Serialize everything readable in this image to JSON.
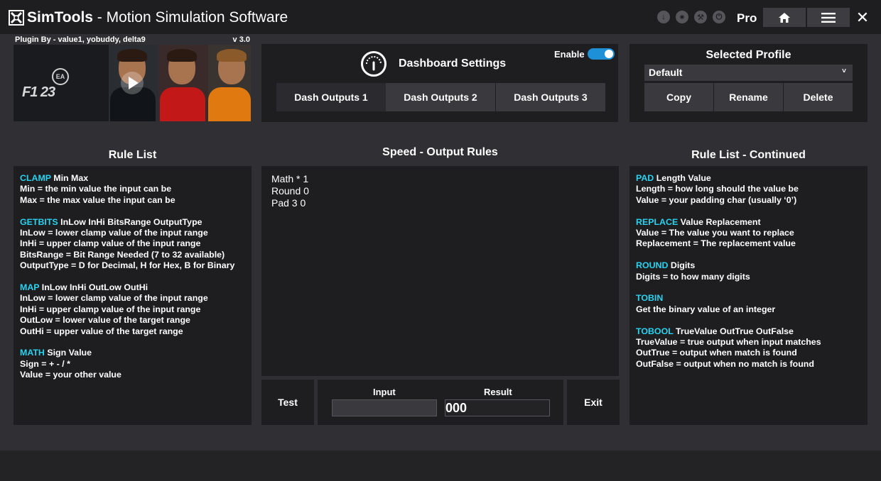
{
  "app": {
    "title_brand": "SimTools",
    "title_rest": " - Motion Simulation Software",
    "edition": "Pro"
  },
  "titlebar_icons": [
    "download-icon",
    "badge-icon",
    "wrench-icon",
    "power-icon",
    "home-icon",
    "menu-icon",
    "close-icon"
  ],
  "plugin": {
    "by": "Plugin By - value1, yobuddy, delta9",
    "version": "v 3.0",
    "ea_logo": "EA",
    "game_logo": "F1 23"
  },
  "dashboard": {
    "title": "Dashboard Settings",
    "enable_label": "Enable",
    "enabled": true,
    "tabs": [
      "Dash Outputs 1",
      "Dash Outputs 2",
      "Dash Outputs 3"
    ],
    "active_tab": 0
  },
  "profile": {
    "title": "Selected Profile",
    "selected": "Default",
    "buttons": [
      "Copy",
      "Rename",
      "Delete"
    ]
  },
  "rule_list": {
    "title": "Rule List",
    "rules": [
      {
        "keyword": "CLAMP",
        "params": " Min Max",
        "lines": [
          "Min = the min value the input can be",
          "Max = the max value the input can be"
        ]
      },
      {
        "keyword": "GETBITS",
        "params": " InLow InHi BitsRange OutputType",
        "lines": [
          "InLow = lower clamp value of the input range",
          "InHi = upper clamp value of the input range",
          "BitsRange = Bit Range Needed (7 to 32 available)",
          "OutputType = D for Decimal, H for Hex, B for Binary"
        ]
      },
      {
        "keyword": "MAP",
        "params": " InLow InHi OutLow OutHi",
        "lines": [
          "InLow = lower clamp value of the input range",
          "InHi = upper clamp value of the input range",
          "OutLow = lower value of the target range",
          "OutHi = upper value of the target range"
        ]
      },
      {
        "keyword": "MATH",
        "params": " Sign Value",
        "lines": [
          "Sign = + - / *",
          "Value = your other value"
        ]
      }
    ]
  },
  "output_rules": {
    "title": "Speed - Output Rules",
    "lines": [
      "Math * 1",
      "Round 0",
      "Pad 3 0"
    ]
  },
  "rule_list_continued": {
    "title": "Rule List - Continued",
    "rules": [
      {
        "keyword": "PAD",
        "params": " Length Value",
        "lines": [
          "Length = how long should the value be",
          "Value = your padding char (usually ‘0’)"
        ]
      },
      {
        "keyword": "REPLACE",
        "params": " Value Replacement",
        "lines": [
          "Value = The value you want to replace",
          "Replacement = The replacement value"
        ]
      },
      {
        "keyword": "ROUND",
        "params": " Digits",
        "lines": [
          "Digits = to how many digits"
        ]
      },
      {
        "keyword": "TOBIN",
        "params": "",
        "lines": [
          "Get the binary value of an integer"
        ]
      },
      {
        "keyword": "TOBOOL",
        "params": " TrueValue OutTrue OutFalse",
        "lines": [
          "TrueValue = true output when input matches",
          "OutTrue = output when match is found",
          "OutFalse = output when no match is found"
        ]
      }
    ]
  },
  "test": {
    "test_label": "Test",
    "input_label": "Input",
    "input_value": "",
    "result_label": "Result",
    "result_value": "000",
    "exit_label": "Exit"
  },
  "colors": {
    "keyword": "#29d3ef",
    "toggle": "#1e90d8",
    "panel": "#1e1e21",
    "background": "#303034"
  }
}
